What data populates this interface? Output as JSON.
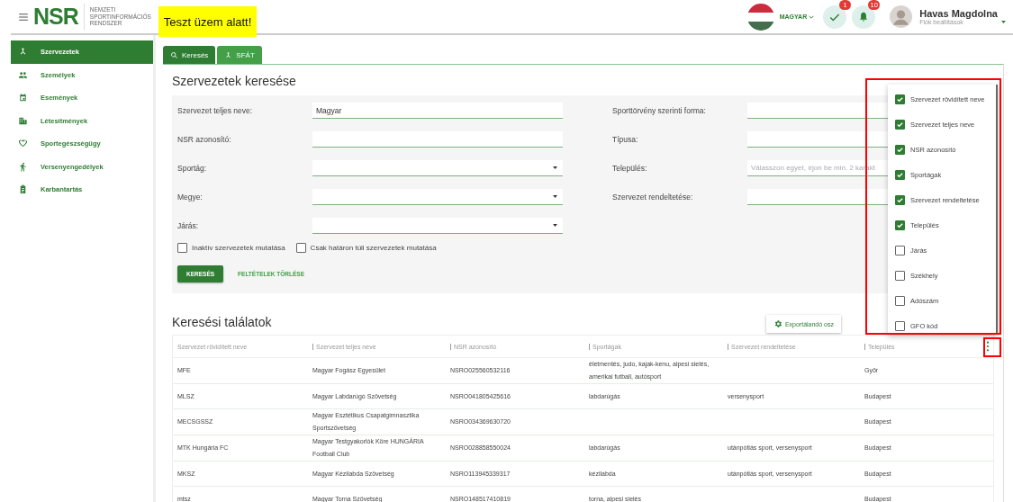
{
  "header": {
    "logo": {
      "mark": "NSR",
      "subtitle": [
        "NEMZETI",
        "SPORTINFORMÁCIÓS",
        "RENDSZER"
      ]
    },
    "test_banner": "Teszt üzem alatt!",
    "language": "MAGYAR",
    "tasks_badge": "1",
    "notifications_badge": "10",
    "user": {
      "name": "Havas Magdolna",
      "subtitle": "Fiók beállítások"
    }
  },
  "sidebar": {
    "items": [
      {
        "label": "Szervezetek",
        "selected": true
      },
      {
        "label": "Személyek",
        "selected": false
      },
      {
        "label": "Események",
        "selected": false
      },
      {
        "label": "Létesítmények",
        "selected": false
      },
      {
        "label": "Sportegészségügy",
        "selected": false
      },
      {
        "label": "Versenyengedélyek",
        "selected": false
      },
      {
        "label": "Karbantartás",
        "selected": false
      }
    ]
  },
  "tabs": [
    {
      "label": "Keresés",
      "selected": true
    },
    {
      "label": "SFÁT",
      "selected": false
    }
  ],
  "search": {
    "title": "Szervezetek keresése",
    "left_fields": [
      {
        "label": "Szervezet teljes neve:",
        "kind": "text",
        "value": "Magyar"
      },
      {
        "label": "NSR azonosító:",
        "kind": "text"
      },
      {
        "label": "Sportág:",
        "kind": "select"
      },
      {
        "label": "Megye:",
        "kind": "select"
      },
      {
        "label": "Járás:",
        "kind": "select"
      }
    ],
    "right_fields": [
      {
        "label": "Sporttörvény szerinti forma:"
      },
      {
        "label": "Típusa:"
      },
      {
        "label": "Település:",
        "placeholder": "Válasszon egyet, írjon be min. 2 karakt"
      },
      {
        "label": "Szervezet rendeltetése:"
      }
    ],
    "checkboxes": [
      {
        "label": "Inaktív szervezetek mutatása",
        "checked": false
      },
      {
        "label": "Csak határon túli szervezetek mutatása",
        "checked": false
      }
    ],
    "search_button": "KERESÉS",
    "clear_link": "FELTÉTELEK TÖRLÉSE"
  },
  "results": {
    "title": "Keresési találatok",
    "export_button": "Exportálandó osz",
    "columns": [
      "Szervezet rövidített neve",
      "Szervezet teljes neve",
      "NSR azonosító",
      "Sportágak",
      "Szervezet rendeltetése",
      "Település"
    ],
    "rows": [
      [
        "MFE",
        "Magyar Fogász Egyesület",
        "NSRO025560532116",
        "életmentés, judo, kajak-kenu, alpesi sielés, amerikai futball, autósport",
        "",
        "Győr"
      ],
      [
        "MLSZ",
        "Magyar Labdarúgó Szövetség",
        "NSRO041805425616",
        "labdarúgás",
        "versenysport",
        "Budapest"
      ],
      [
        "MECSGSSZ",
        "Magyar Esztétikus Csapatgimnasztika Sportszövetség",
        "NSRO034369630720",
        "",
        "",
        "Budapest"
      ],
      [
        "MTK Hungária FC",
        "Magyar Testgyakorlók Köre HUNGÁRIA Football Club",
        "NSRO028858550024",
        "labdarúgás",
        "utánpótlás sport, versenysport",
        "Budapest"
      ],
      [
        "MKSZ",
        "Magyar Kézilabda Szövetség",
        "NSRO113945339317",
        "kézilabda",
        "utánpótlás sport, versenysport",
        "Budapest"
      ],
      [
        "mtsz",
        "Magyar Torna Szövetség",
        "NSRO148517410819",
        "torna, alpesi sielés",
        "",
        "Budapest"
      ]
    ]
  },
  "column_menu": {
    "items": [
      {
        "label": "Szervezet rövidített neve",
        "checked": true
      },
      {
        "label": "Szervezet teljes neve",
        "checked": true
      },
      {
        "label": "NSR azonosító",
        "checked": true
      },
      {
        "label": "Sportágak",
        "checked": true
      },
      {
        "label": "Szervezet rendeltetése",
        "checked": true
      },
      {
        "label": "Település",
        "checked": true
      },
      {
        "label": "Járás",
        "checked": false
      },
      {
        "label": "Székhely",
        "checked": false
      },
      {
        "label": "Adószám",
        "checked": false
      },
      {
        "label": "GFO kód",
        "checked": false
      }
    ]
  }
}
